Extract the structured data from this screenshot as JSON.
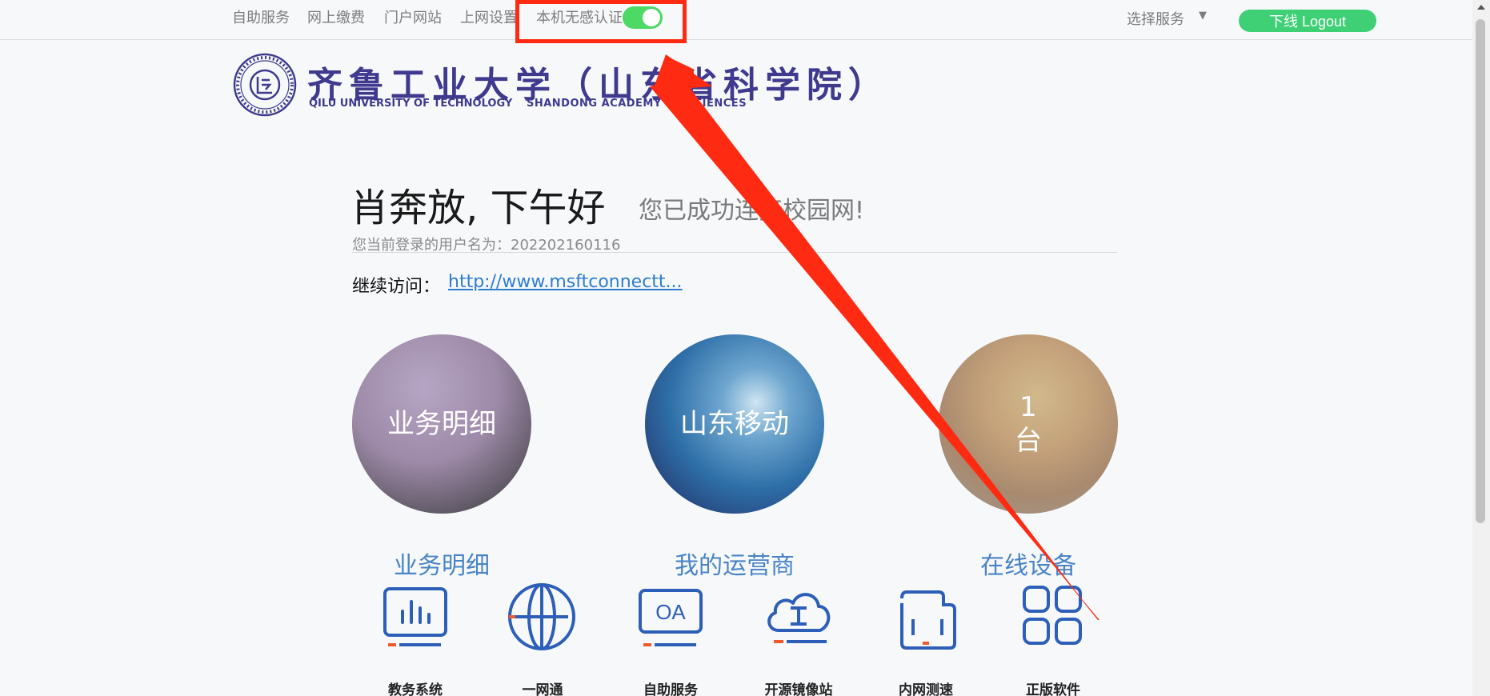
{
  "topnav": {
    "items": [
      "自助服务",
      "网上缴费",
      "门户网站",
      "上网设置"
    ],
    "toggle_label": "本机无感认证",
    "toggle_on": true,
    "service_select": "选择服务",
    "logout": "下线 Logout"
  },
  "logo": {
    "cn": "齐鲁工业大学（山东省科学院）",
    "en_left": "QILU UNIVERSITY OF TECHNOLOGY",
    "en_right": "SHANDONG  ACADEMY  OF  SCIENCES"
  },
  "greeting": {
    "title": "肖奔放, 下午好",
    "connected": "您已成功连接校园网!",
    "username_line": "您当前登录的用户名为：202202160116",
    "continue_label": "继续访问：",
    "continue_link": "http://www.msftconnectt..."
  },
  "circles": [
    {
      "text": "业务明细",
      "caption": "业务明细"
    },
    {
      "text": "山东移动",
      "caption": "我的运营商"
    },
    {
      "text_line1": "1",
      "text_line2": "台",
      "caption": "在线设备"
    }
  ],
  "apps": [
    {
      "label": "教务系统",
      "icon": "chart-monitor-icon"
    },
    {
      "label": "一网通",
      "icon": "globe-icon"
    },
    {
      "label": "自助服务",
      "icon": "oa-icon"
    },
    {
      "label": "开源镜像站",
      "icon": "cloud-icon"
    },
    {
      "label": "内网测速",
      "icon": "wallet-icon"
    },
    {
      "label": "正版软件",
      "icon": "grid-icon"
    }
  ],
  "colors": {
    "accent_blue": "#2e5fb8",
    "accent_orange": "#f15a2b",
    "toggle_green": "#4cd964",
    "logout_green": "#3fcf75",
    "annotation_red": "#ff2a12"
  }
}
